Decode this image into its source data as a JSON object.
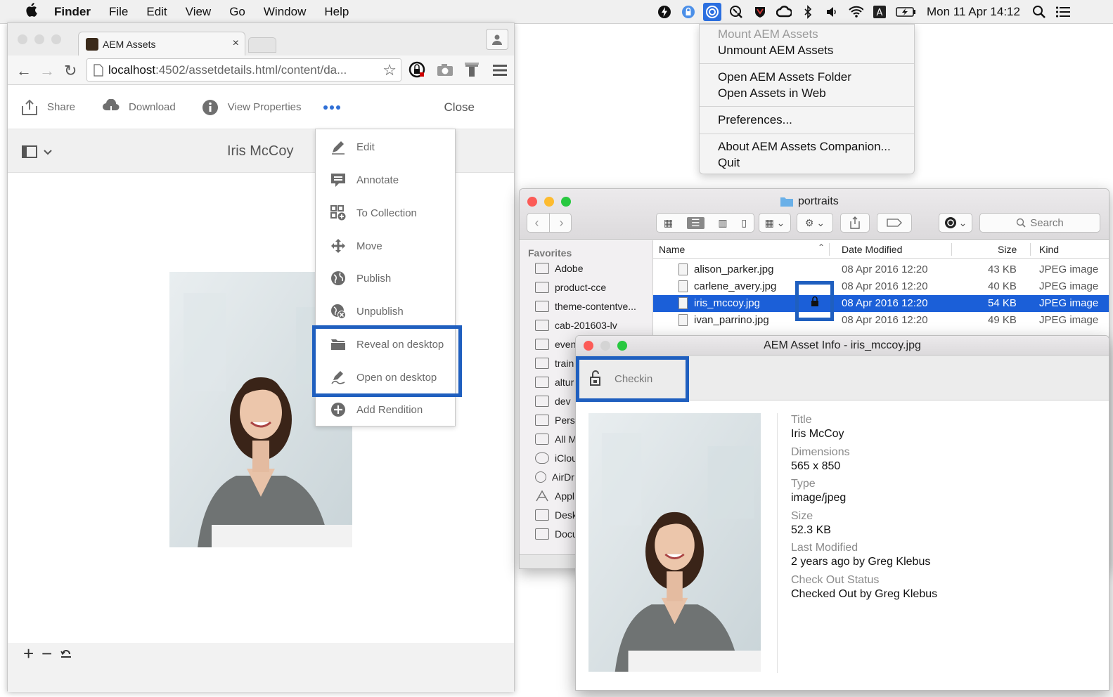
{
  "menubar": {
    "app": "Finder",
    "items": [
      "File",
      "Edit",
      "View",
      "Go",
      "Window",
      "Help"
    ],
    "clock": "Mon 11 Apr  14:12"
  },
  "browser": {
    "tab_title": "AEM Assets",
    "url_host": "localhost",
    "url_path": ":4502/assetdetails.html/content/da...",
    "toolbar": {
      "share": "Share",
      "download": "Download",
      "view_properties": "View Properties",
      "close": "Close"
    },
    "asset_title": "Iris McCoy",
    "more_menu": [
      {
        "label": "Edit",
        "icon": "pencil-icon"
      },
      {
        "label": "Annotate",
        "icon": "annotate-icon"
      },
      {
        "label": "To Collection",
        "icon": "collection-icon"
      },
      {
        "label": "Move",
        "icon": "move-icon"
      },
      {
        "label": "Publish",
        "icon": "globe-icon"
      },
      {
        "label": "Unpublish",
        "icon": "globe-remove-icon"
      },
      {
        "label": "Reveal on desktop",
        "icon": "folder-icon"
      },
      {
        "label": "Open on desktop",
        "icon": "open-edit-icon"
      },
      {
        "label": "Add Rendition",
        "icon": "add-circle-icon"
      }
    ]
  },
  "status_menu": {
    "mount": "Mount AEM Assets",
    "unmount": "Unmount AEM Assets",
    "open_folder": "Open AEM Assets Folder",
    "open_web": "Open Assets in Web",
    "preferences": "Preferences...",
    "about": "About AEM Assets Companion...",
    "quit": "Quit"
  },
  "finder": {
    "title": "portraits",
    "search_placeholder": "Search",
    "sidebar_header": "Favorites",
    "sidebar": [
      "Adobe",
      "product-cce",
      "theme-contentve...",
      "cab-201603-lv",
      "even",
      "train",
      "altur",
      "dev",
      "Pers",
      "All M",
      "iClou",
      "AirDr",
      "Appl",
      "Desk",
      "Docu"
    ],
    "columns": {
      "name": "Name",
      "date": "Date Modified",
      "size": "Size",
      "kind": "Kind"
    },
    "files": [
      {
        "name": "alison_parker.jpg",
        "date": "08 Apr 2016 12:20",
        "size": "43 KB",
        "kind": "JPEG image"
      },
      {
        "name": "carlene_avery.jpg",
        "date": "08 Apr 2016 12:20",
        "size": "40 KB",
        "kind": "JPEG image"
      },
      {
        "name": "iris_mccoy.jpg",
        "date": "08 Apr 2016 12:20",
        "size": "54 KB",
        "kind": "JPEG image"
      },
      {
        "name": "ivan_parrino.jpg",
        "date": "08 Apr 2016 12:20",
        "size": "49 KB",
        "kind": "JPEG image"
      }
    ]
  },
  "info": {
    "title": "AEM Asset Info - iris_mccoy.jpg",
    "checkin": "Checkin",
    "fields": [
      {
        "label": "Title",
        "value": "Iris McCoy"
      },
      {
        "label": "Dimensions",
        "value": "565 x 850"
      },
      {
        "label": "Type",
        "value": "image/jpeg"
      },
      {
        "label": "Size",
        "value": "52.3 KB"
      },
      {
        "label": "Last Modified",
        "value": "2 years ago by Greg Klebus"
      },
      {
        "label": "Check Out Status",
        "value": "Checked Out by Greg Klebus"
      }
    ]
  },
  "colors": {
    "highlight": "#1f5fbf",
    "selection": "#1b5fd8"
  }
}
